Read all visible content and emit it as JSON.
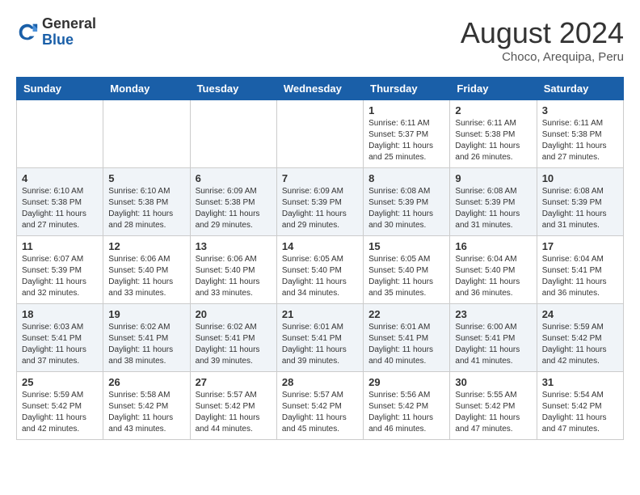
{
  "header": {
    "logo_line1": "General",
    "logo_line2": "Blue",
    "month_title": "August 2024",
    "location": "Choco, Arequipa, Peru"
  },
  "weekdays": [
    "Sunday",
    "Monday",
    "Tuesday",
    "Wednesday",
    "Thursday",
    "Friday",
    "Saturday"
  ],
  "weeks": [
    [
      {
        "day": "",
        "info": ""
      },
      {
        "day": "",
        "info": ""
      },
      {
        "day": "",
        "info": ""
      },
      {
        "day": "",
        "info": ""
      },
      {
        "day": "1",
        "info": "Sunrise: 6:11 AM\nSunset: 5:37 PM\nDaylight: 11 hours and 25 minutes."
      },
      {
        "day": "2",
        "info": "Sunrise: 6:11 AM\nSunset: 5:38 PM\nDaylight: 11 hours and 26 minutes."
      },
      {
        "day": "3",
        "info": "Sunrise: 6:11 AM\nSunset: 5:38 PM\nDaylight: 11 hours and 27 minutes."
      }
    ],
    [
      {
        "day": "4",
        "info": "Sunrise: 6:10 AM\nSunset: 5:38 PM\nDaylight: 11 hours and 27 minutes."
      },
      {
        "day": "5",
        "info": "Sunrise: 6:10 AM\nSunset: 5:38 PM\nDaylight: 11 hours and 28 minutes."
      },
      {
        "day": "6",
        "info": "Sunrise: 6:09 AM\nSunset: 5:38 PM\nDaylight: 11 hours and 29 minutes."
      },
      {
        "day": "7",
        "info": "Sunrise: 6:09 AM\nSunset: 5:39 PM\nDaylight: 11 hours and 29 minutes."
      },
      {
        "day": "8",
        "info": "Sunrise: 6:08 AM\nSunset: 5:39 PM\nDaylight: 11 hours and 30 minutes."
      },
      {
        "day": "9",
        "info": "Sunrise: 6:08 AM\nSunset: 5:39 PM\nDaylight: 11 hours and 31 minutes."
      },
      {
        "day": "10",
        "info": "Sunrise: 6:08 AM\nSunset: 5:39 PM\nDaylight: 11 hours and 31 minutes."
      }
    ],
    [
      {
        "day": "11",
        "info": "Sunrise: 6:07 AM\nSunset: 5:39 PM\nDaylight: 11 hours and 32 minutes."
      },
      {
        "day": "12",
        "info": "Sunrise: 6:06 AM\nSunset: 5:40 PM\nDaylight: 11 hours and 33 minutes."
      },
      {
        "day": "13",
        "info": "Sunrise: 6:06 AM\nSunset: 5:40 PM\nDaylight: 11 hours and 33 minutes."
      },
      {
        "day": "14",
        "info": "Sunrise: 6:05 AM\nSunset: 5:40 PM\nDaylight: 11 hours and 34 minutes."
      },
      {
        "day": "15",
        "info": "Sunrise: 6:05 AM\nSunset: 5:40 PM\nDaylight: 11 hours and 35 minutes."
      },
      {
        "day": "16",
        "info": "Sunrise: 6:04 AM\nSunset: 5:40 PM\nDaylight: 11 hours and 36 minutes."
      },
      {
        "day": "17",
        "info": "Sunrise: 6:04 AM\nSunset: 5:41 PM\nDaylight: 11 hours and 36 minutes."
      }
    ],
    [
      {
        "day": "18",
        "info": "Sunrise: 6:03 AM\nSunset: 5:41 PM\nDaylight: 11 hours and 37 minutes."
      },
      {
        "day": "19",
        "info": "Sunrise: 6:02 AM\nSunset: 5:41 PM\nDaylight: 11 hours and 38 minutes."
      },
      {
        "day": "20",
        "info": "Sunrise: 6:02 AM\nSunset: 5:41 PM\nDaylight: 11 hours and 39 minutes."
      },
      {
        "day": "21",
        "info": "Sunrise: 6:01 AM\nSunset: 5:41 PM\nDaylight: 11 hours and 39 minutes."
      },
      {
        "day": "22",
        "info": "Sunrise: 6:01 AM\nSunset: 5:41 PM\nDaylight: 11 hours and 40 minutes."
      },
      {
        "day": "23",
        "info": "Sunrise: 6:00 AM\nSunset: 5:41 PM\nDaylight: 11 hours and 41 minutes."
      },
      {
        "day": "24",
        "info": "Sunrise: 5:59 AM\nSunset: 5:42 PM\nDaylight: 11 hours and 42 minutes."
      }
    ],
    [
      {
        "day": "25",
        "info": "Sunrise: 5:59 AM\nSunset: 5:42 PM\nDaylight: 11 hours and 42 minutes."
      },
      {
        "day": "26",
        "info": "Sunrise: 5:58 AM\nSunset: 5:42 PM\nDaylight: 11 hours and 43 minutes."
      },
      {
        "day": "27",
        "info": "Sunrise: 5:57 AM\nSunset: 5:42 PM\nDaylight: 11 hours and 44 minutes."
      },
      {
        "day": "28",
        "info": "Sunrise: 5:57 AM\nSunset: 5:42 PM\nDaylight: 11 hours and 45 minutes."
      },
      {
        "day": "29",
        "info": "Sunrise: 5:56 AM\nSunset: 5:42 PM\nDaylight: 11 hours and 46 minutes."
      },
      {
        "day": "30",
        "info": "Sunrise: 5:55 AM\nSunset: 5:42 PM\nDaylight: 11 hours and 47 minutes."
      },
      {
        "day": "31",
        "info": "Sunrise: 5:54 AM\nSunset: 5:42 PM\nDaylight: 11 hours and 47 minutes."
      }
    ]
  ]
}
